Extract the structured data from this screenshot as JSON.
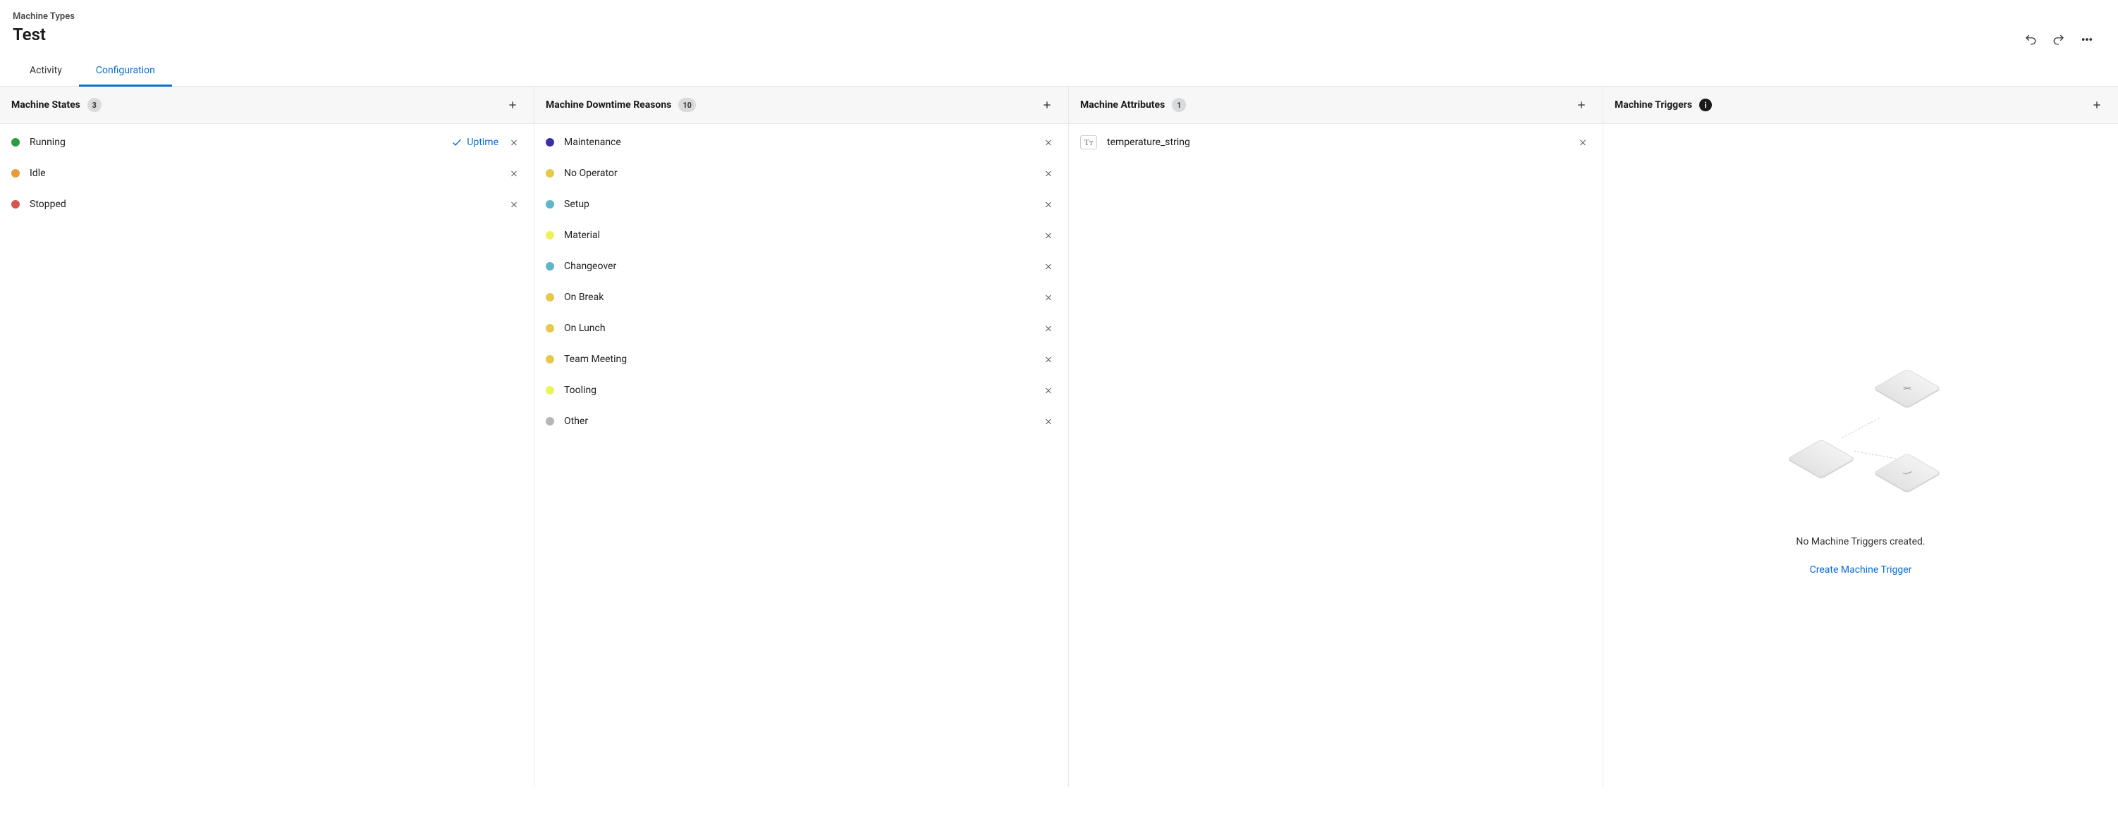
{
  "breadcrumb": "Machine Types",
  "title": "Test",
  "tabs": [
    {
      "label": "Activity",
      "active": false
    },
    {
      "label": "Configuration",
      "active": true
    }
  ],
  "panels": {
    "states": {
      "title": "Machine States",
      "count": "3",
      "uptime_label": "Uptime",
      "items": [
        {
          "label": "Running",
          "color": "#2e9b40",
          "uptime": true
        },
        {
          "label": "Idle",
          "color": "#e89b3c",
          "uptime": false
        },
        {
          "label": "Stopped",
          "color": "#d9534f",
          "uptime": false
        }
      ]
    },
    "reasons": {
      "title": "Machine Downtime Reasons",
      "count": "10",
      "items": [
        {
          "label": "Maintenance",
          "color": "#3a2fa6"
        },
        {
          "label": "No Operator",
          "color": "#e6c94b"
        },
        {
          "label": "Setup",
          "color": "#5fb6c9"
        },
        {
          "label": "Material",
          "color": "#ecf25a"
        },
        {
          "label": "Changeover",
          "color": "#5fb6c9"
        },
        {
          "label": "On Break",
          "color": "#e6c94b"
        },
        {
          "label": "On Lunch",
          "color": "#e6c94b"
        },
        {
          "label": "Team Meeting",
          "color": "#e6c94b"
        },
        {
          "label": "Tooling",
          "color": "#ecf25a"
        },
        {
          "label": "Other",
          "color": "#b6b6b6"
        }
      ]
    },
    "attributes": {
      "title": "Machine Attributes",
      "count": "1",
      "items": [
        {
          "label": "temperature_string",
          "type_glyph": "Tт"
        }
      ]
    },
    "triggers": {
      "title": "Machine Triggers",
      "empty_text": "No Machine Triggers created.",
      "create_label": "Create Machine Trigger"
    }
  }
}
